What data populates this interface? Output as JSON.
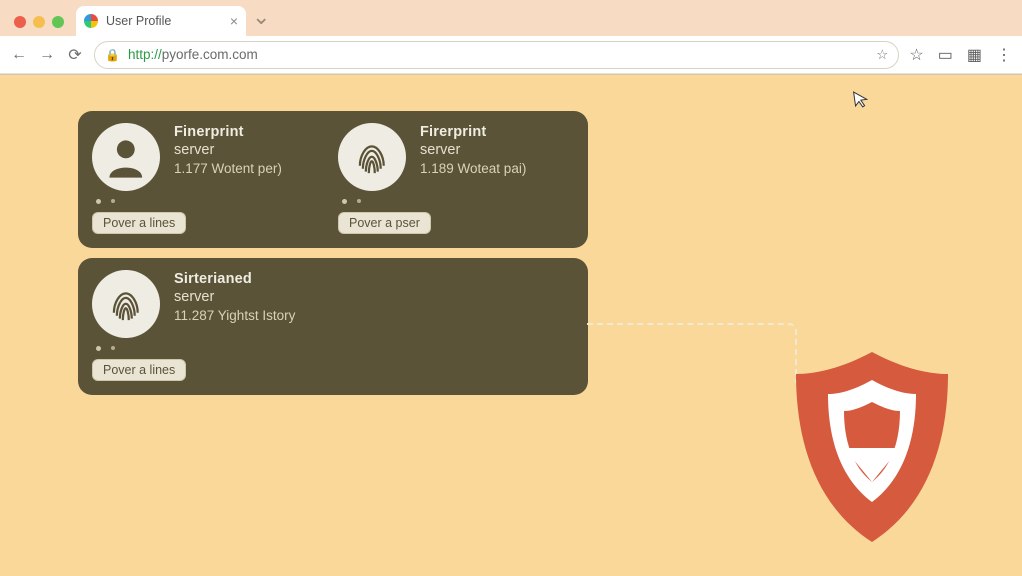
{
  "browser": {
    "tab_title": "User Profile",
    "url_proto": "http://",
    "url_host": "pyorfe.com.com",
    "icons": {
      "back": "back-icon",
      "forward": "forward-icon",
      "reload": "reload-icon",
      "lock": "lock-icon",
      "star_addr": "bookmark-star-icon",
      "star": "star-outline-icon",
      "cast": "cast-icon",
      "apps": "apps-grid-icon",
      "menu": "kebab-menu-icon",
      "close_tab": "close-icon",
      "new_tab": "new-tab-icon"
    }
  },
  "cards": [
    {
      "entries": [
        {
          "avatar": "person",
          "title": "Finerprint",
          "subtitle": "server",
          "meta": "1.177 Wotent per)",
          "button": "Pover a lines"
        },
        {
          "avatar": "fingerprint",
          "title": "Firerprint",
          "subtitle": "server",
          "meta": "1.189 Woteat pai)",
          "button": "Pover a pser"
        }
      ]
    },
    {
      "entries": [
        {
          "avatar": "fingerprint",
          "title": "Sirterianed",
          "subtitle": "server",
          "meta": "11.287 Yightst Istory",
          "button": "Pover a lines"
        }
      ]
    }
  ],
  "decor": {
    "shield": "shield-icon",
    "cursor": "cursor-icon"
  }
}
